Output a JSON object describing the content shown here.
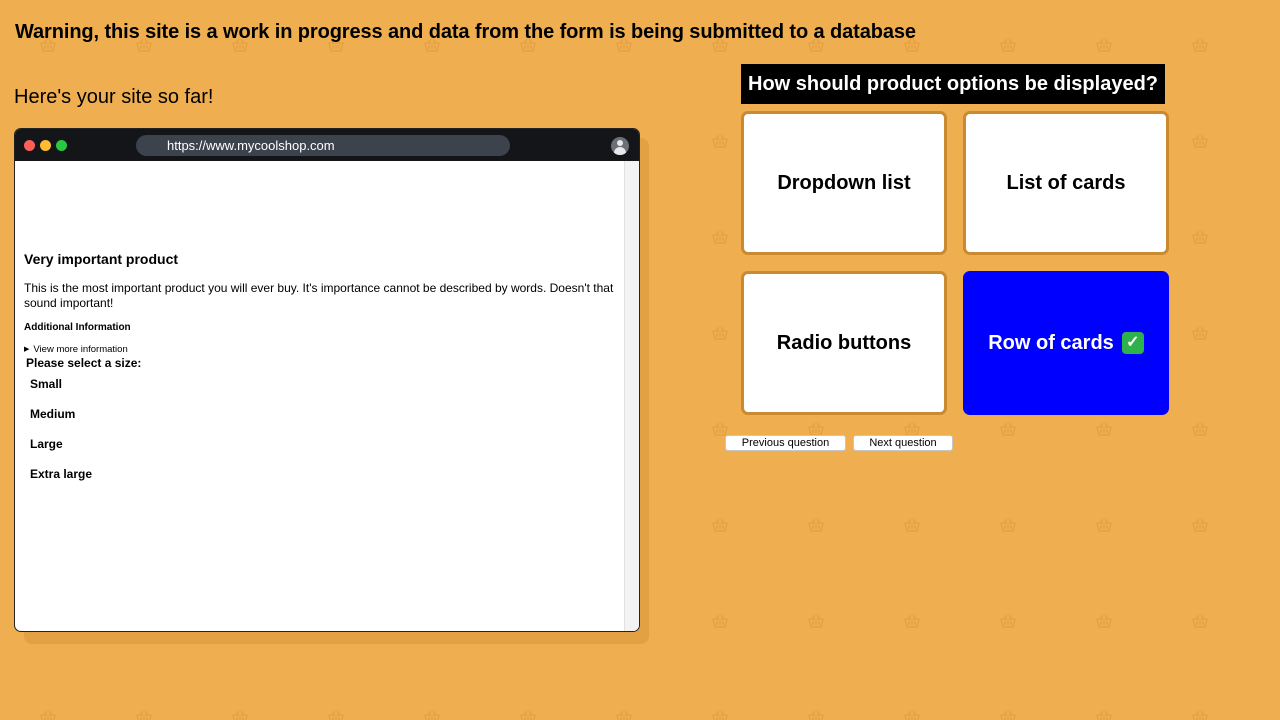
{
  "warning": "Warning, this site is a work in progress and data from the form is being submitted to a database",
  "intro": "Here's your site so far!",
  "browser": {
    "url": "https://www.mycoolshop.com",
    "product": {
      "title": "Very important product",
      "description": "This is the most important product you will ever buy. It's importance cannot be described by words. Doesn't that sound important!",
      "additional_heading": "Additional Information",
      "details_summary": "View more information",
      "size_prompt": "Please select a size:",
      "sizes": [
        "Small",
        "Medium",
        "Large",
        "Extra large"
      ]
    }
  },
  "quiz": {
    "question": "How should product options be displayed?",
    "options": [
      {
        "label": "Dropdown list",
        "selected": false
      },
      {
        "label": "List of cards",
        "selected": false
      },
      {
        "label": "Radio buttons",
        "selected": false
      },
      {
        "label": "Row of cards",
        "selected": true
      }
    ],
    "prev_label": "Previous question",
    "next_label": "Next question"
  },
  "colors": {
    "background": "#efae4f",
    "selected_card": "#0000ff",
    "card_border": "#c98a30"
  },
  "icons": {
    "background_pattern": "basket-icon",
    "selected_mark": "check-mark-icon"
  }
}
